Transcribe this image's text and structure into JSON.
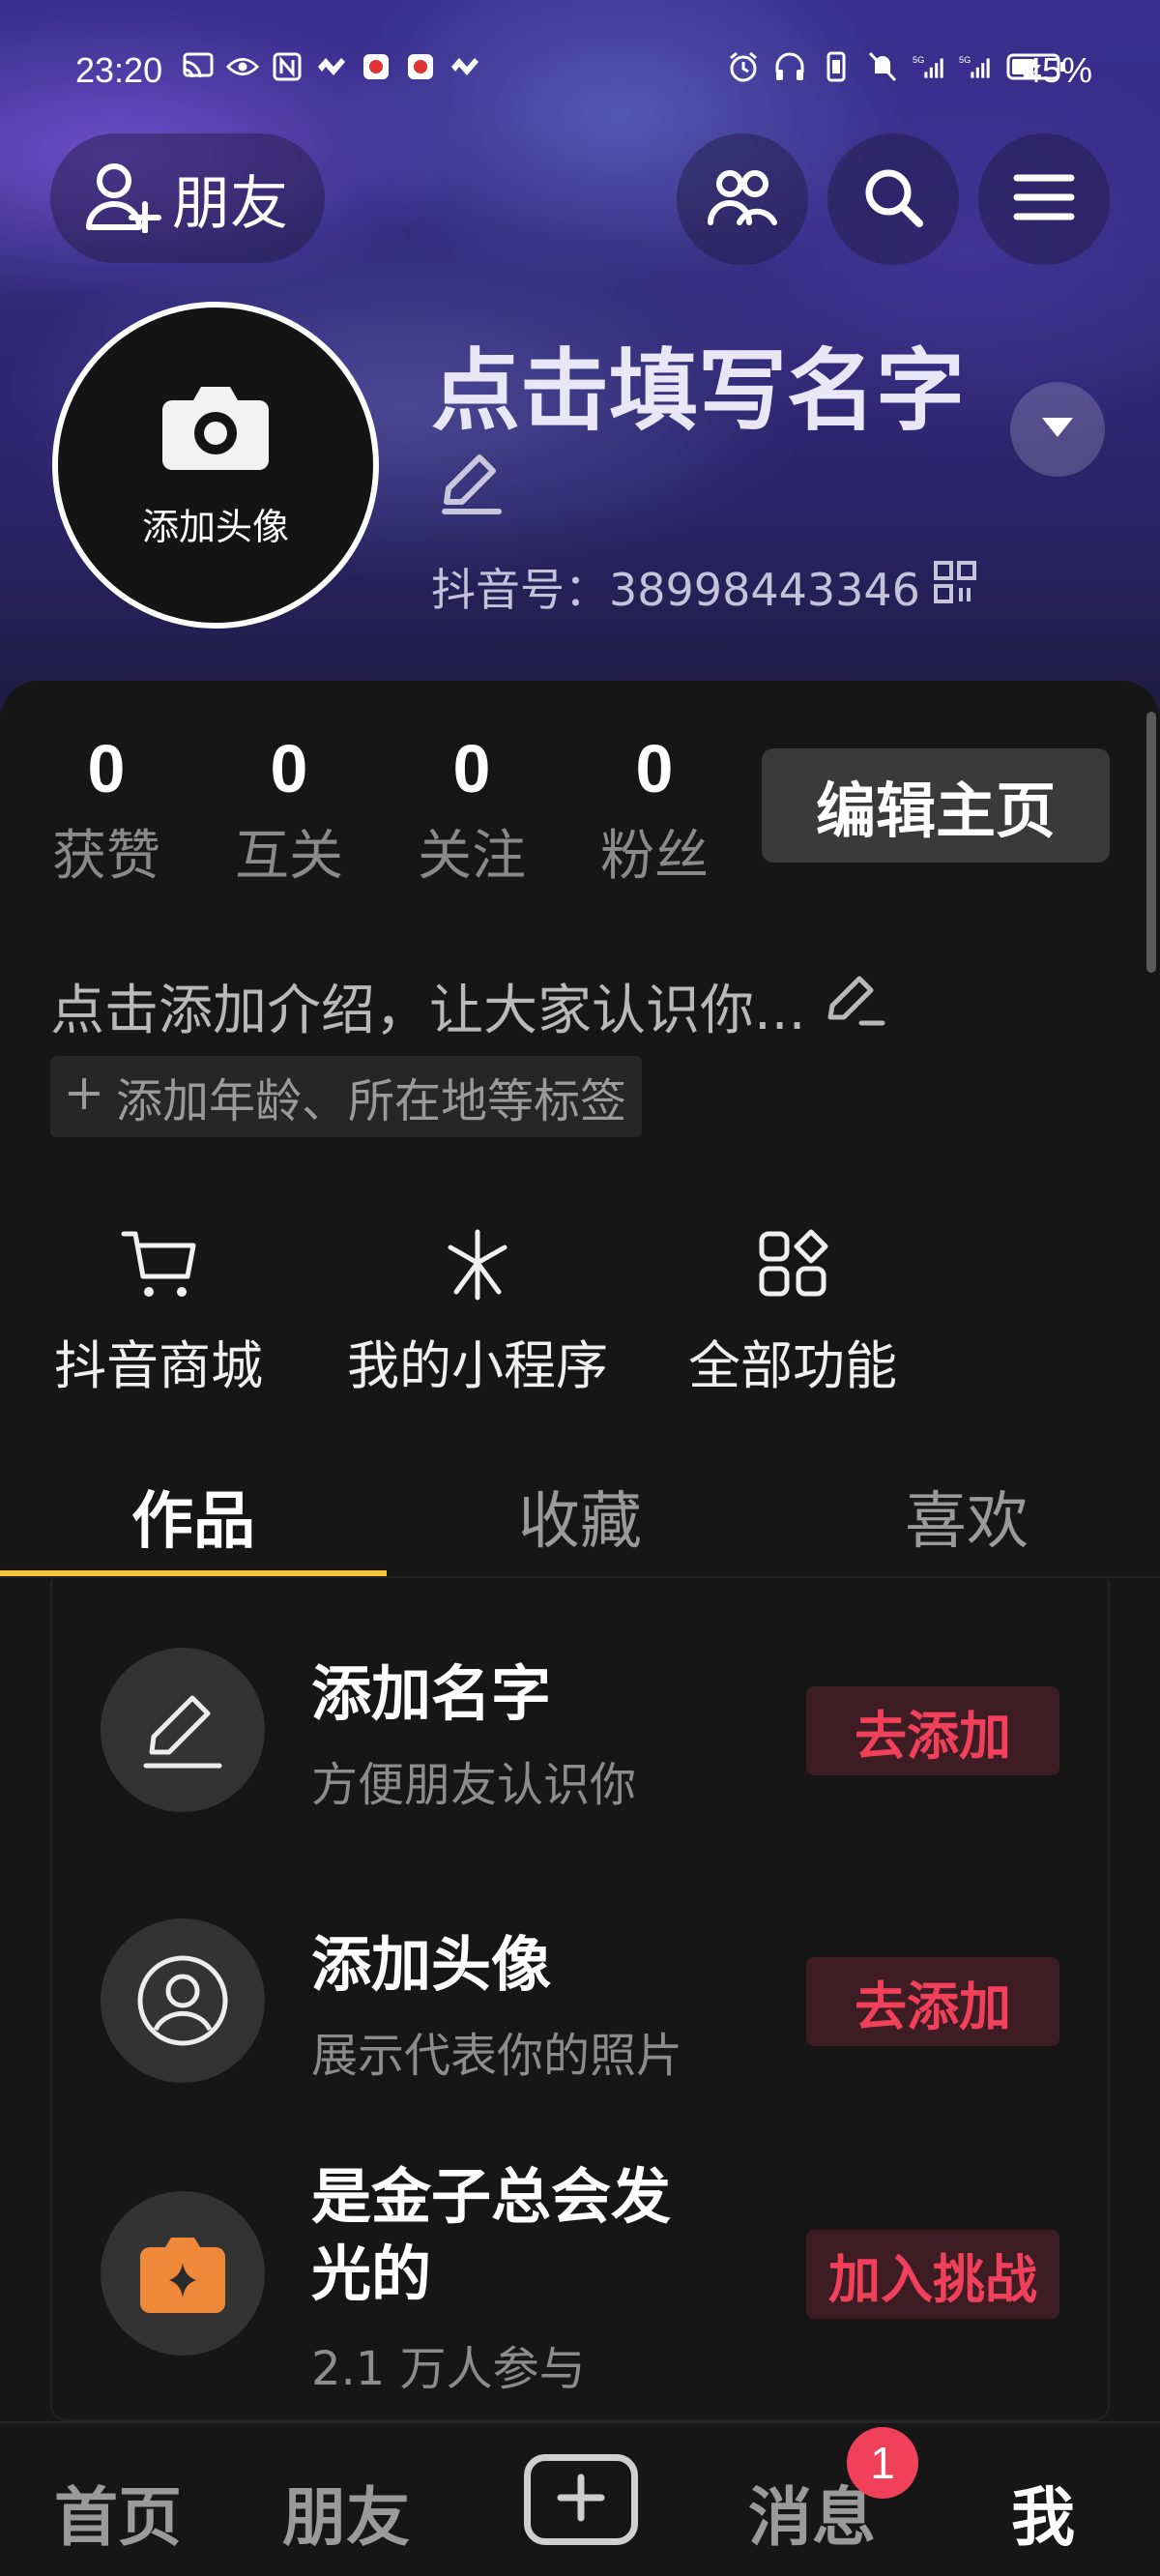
{
  "status_bar": {
    "time": "23:20",
    "battery": "45%"
  },
  "header": {
    "friend_button": "朋友",
    "name": "点击填写名字",
    "douyin_id": "抖音号：38998443346",
    "avatar_label": "添加头像"
  },
  "stats": [
    {
      "value": "0",
      "label": "获赞"
    },
    {
      "value": "0",
      "label": "互关"
    },
    {
      "value": "0",
      "label": "关注"
    },
    {
      "value": "0",
      "label": "粉丝"
    }
  ],
  "edit_profile_label": "编辑主页",
  "intro_placeholder": "点击添加介绍，让大家认识你...",
  "tag_chip": "添加年龄、所在地等标签",
  "features": [
    {
      "label": "抖音商城",
      "icon": "cart-icon"
    },
    {
      "label": "我的小程序",
      "icon": "mini-program-icon"
    },
    {
      "label": "全部功能",
      "icon": "all-functions-icon"
    }
  ],
  "tabs": [
    "作品",
    "收藏",
    "喜欢"
  ],
  "tasks": [
    {
      "title": "添加名字",
      "subtitle": "方便朋友认识你",
      "button": "去添加",
      "icon": "pencil-icon"
    },
    {
      "title": "添加头像",
      "subtitle": "展示代表你的照片",
      "button": "去添加",
      "icon": "user-circle-icon"
    },
    {
      "title_line1": "是金子总会发",
      "title_line2": "光的",
      "subtitle": "2.1 万人参与",
      "button": "加入挑战",
      "icon": "challenge-icon"
    }
  ],
  "bottom_nav": {
    "home": "首页",
    "friends": "朋友",
    "messages": "消息",
    "me": "我",
    "message_badge": "1"
  },
  "colors": {
    "accent_yellow": "#f5c63b",
    "action_red": "#f0405a"
  }
}
